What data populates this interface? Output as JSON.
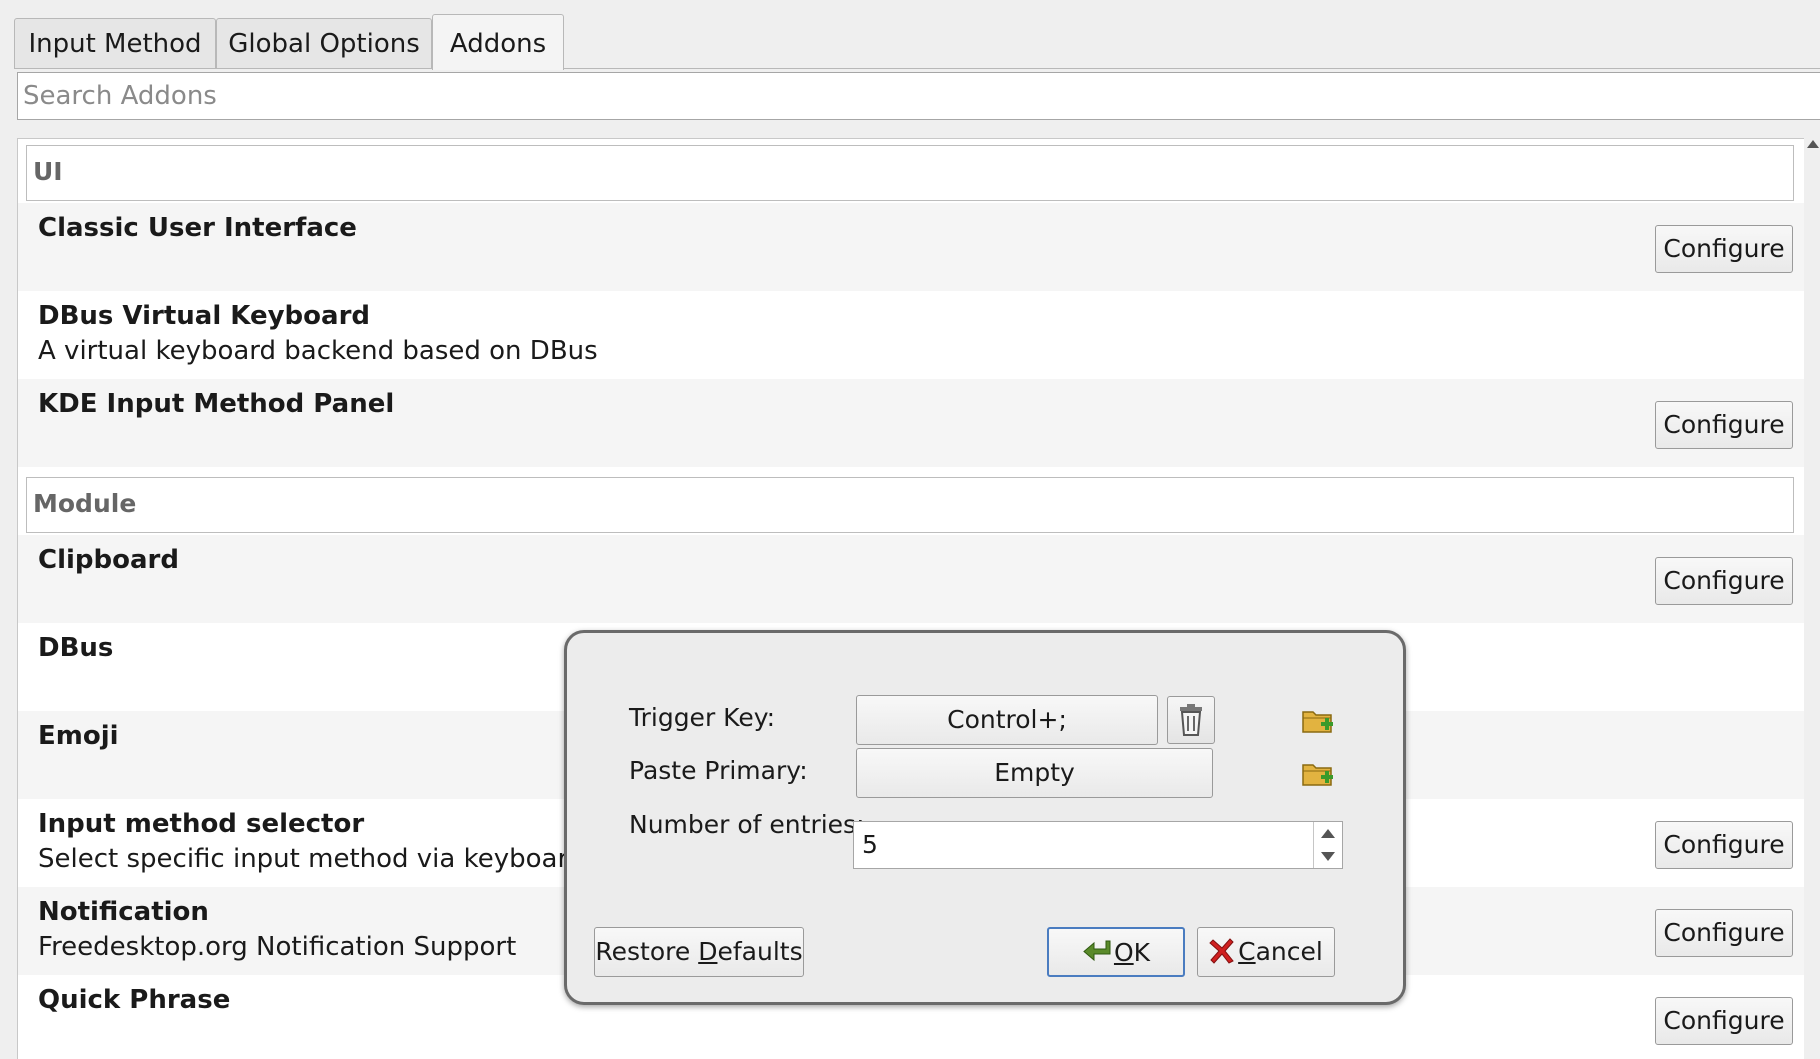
{
  "tabs": [
    {
      "label": "Input Method"
    },
    {
      "label": "Global Options"
    },
    {
      "label": "Addons"
    }
  ],
  "search": {
    "placeholder": "Search Addons"
  },
  "categories": {
    "ui": "UI",
    "module": "Module"
  },
  "addons": [
    {
      "title": "Classic User Interface",
      "desc": "",
      "configure": "Configure"
    },
    {
      "title": "DBus Virtual Keyboard",
      "desc": "A virtual keyboard backend based on DBus"
    },
    {
      "title": "KDE Input Method Panel",
      "desc": "",
      "configure": "Configure"
    },
    {
      "title": "Clipboard",
      "desc": "",
      "configure": "Configure"
    },
    {
      "title": "DBus",
      "desc": ""
    },
    {
      "title": "Emoji",
      "desc": ""
    },
    {
      "title": "Input method selector",
      "desc": "Select specific input method via keyboard",
      "configure": "Configure"
    },
    {
      "title": "Notification",
      "desc": "Freedesktop.org Notification Support",
      "configure": "Configure"
    },
    {
      "title": "Quick Phrase",
      "desc": "",
      "configure": "Configure"
    }
  ],
  "dialog": {
    "trigger_key_label": "Trigger Key:",
    "trigger_key_value": "Control+;",
    "paste_primary_label": "Paste Primary:",
    "paste_primary_value": "Empty",
    "entries_label": "Number of entries:",
    "entries_value": "5",
    "restore_prefix": "Restore ",
    "restore_mnemonic": "D",
    "restore_suffix": "efaults",
    "ok_mnemonic": "O",
    "ok_suffix": "K",
    "cancel_mnemonic": "C",
    "cancel_suffix": "ancel"
  },
  "icons": {
    "delete": "trash-icon",
    "add": "folder-add-icon",
    "ok": "green-arrow-icon",
    "cancel": "red-x-icon"
  },
  "colors": {
    "ok_border": "#4a7cc0",
    "folder": "#e2b340",
    "add_green": "#3a9a2a",
    "cancel_red": "#d02020",
    "ok_green": "#5a8a2a"
  }
}
